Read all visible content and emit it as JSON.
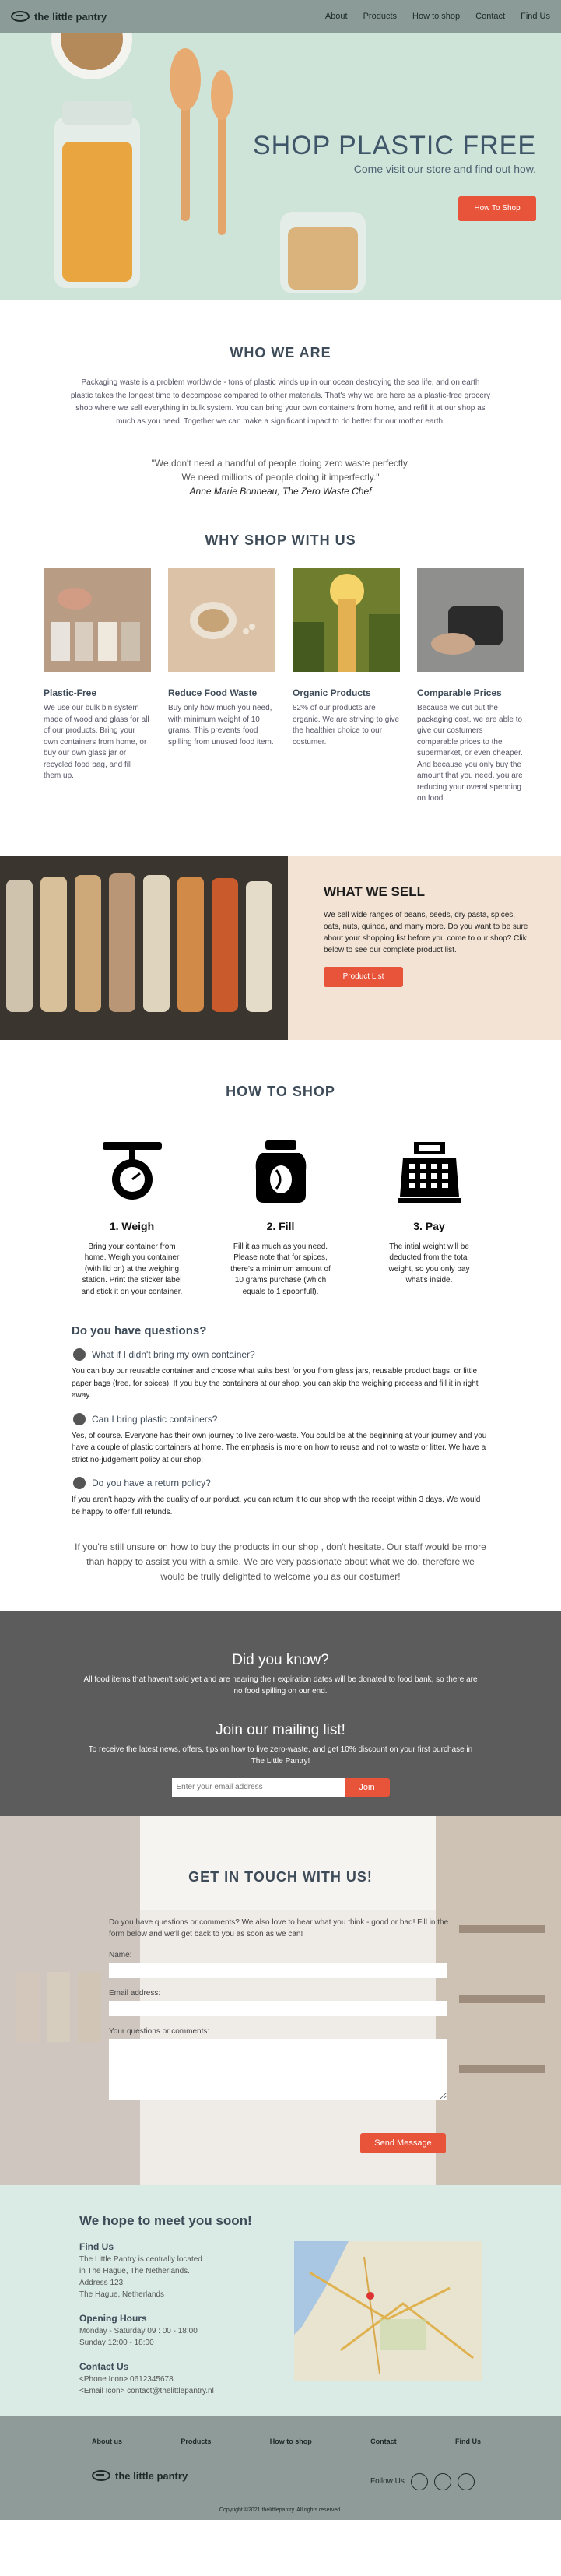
{
  "nav": {
    "brand": "the little pantry",
    "links": [
      "About",
      "Products",
      "How to shop",
      "Contact",
      "Find Us"
    ]
  },
  "hero": {
    "title": "SHOP PLASTIC FREE",
    "subtitle": "Come visit our store and find out how.",
    "button": "How To Shop"
  },
  "who": {
    "title": "WHO WE ARE",
    "text": "Packaging waste is a problem worldwide - tons of plastic winds up in our ocean destroying the sea life, and on earth plastic takes the longest time to decompose compared to other materials. That's why we are here as a plastic-free grocery shop where we sell everything in bulk system. You can bring your own containers from home, and refill it at our shop as much as you need. Together we can make a significant impact to do better for our mother earth!",
    "quote_line1": "\"We don't need a handful of people doing zero waste perfectly.",
    "quote_line2": "We need millions of people doing it imperfectly.\"",
    "quote_author": "Anne Marie Bonneau, The Zero Waste Chef"
  },
  "why": {
    "title": "WHY SHOP WITH US",
    "cards": [
      {
        "title": "Plastic-Free",
        "text": "We use our bulk bin system made of wood and glass for all of our products. Bring your own containers from home, or buy our own glass jar or recycled food bag, and fill them up."
      },
      {
        "title": "Reduce Food Waste",
        "text": "Buy only how much you need, with minimum weight of 10 grams. This prevents food spilling from unused food item."
      },
      {
        "title": "Organic Products",
        "text": "82% of our products are organic. We are striving to give the healthier choice to our costumer."
      },
      {
        "title": "Comparable Prices",
        "text": "Because we cut out the packaging cost, we are able to give our costumers comparable prices to the supermarket, or even cheaper. And because you only buy the amount that you need, you are reducing your overal spending on food."
      }
    ]
  },
  "sell": {
    "title": "WHAT WE SELL",
    "text": "We sell wide ranges of beans, seeds, dry pasta, spices, oats, nuts, quinoa, and many more. Do you want to be sure about your shopping list before you come to our shop? Clik below to see our complete product list.",
    "button": "Product List"
  },
  "how": {
    "title": "HOW TO SHOP",
    "steps": [
      {
        "icon": "scale-icon",
        "title": "1. Weigh",
        "text": "Bring your container from home. Weigh you container (with lid on) at the weighing station. Print the sticker label and stick it on your container."
      },
      {
        "icon": "jar-icon",
        "title": "2. Fill",
        "text": "Fill it as much as you need. Please note that for spices, there's a minimum amount of 10 grams purchase (which equals to 1 spoonfull)."
      },
      {
        "icon": "cash-register-icon",
        "title": "3. Pay",
        "text": "The intial weight will be deducted from the total weight, so you only pay what's inside."
      }
    ]
  },
  "faq": {
    "title": "Do you have questions?",
    "items": [
      {
        "q": "What if I didn't bring my own container?",
        "a": "You can buy our reusable container and choose what suits best for you from glass jars, reusable product bags, or little paper bags (free, for spices). If you buy the containers at our shop, you can skip the weighing process and fill it in right away."
      },
      {
        "q": "Can I bring plastic containers?",
        "a": "Yes, of course. Everyone has their own journey to live zero-waste. You could be at the beginning at your journey and you have a couple of plastic containers at home. The emphasis is more on how to reuse and not to waste or litter. We have a strict no-judgement policy at our shop!"
      },
      {
        "q": "Do you have a return policy?",
        "a": "If you aren't happy with the quality of our porduct, you can return it to our shop with the receipt within 3 days. We would be happy to offer full refunds."
      }
    ],
    "closing": "If you're still unsure on how to buy the products in our shop , don't hesitate. Our staff would be more than happy to assist you with a smile. We are very passionate about what we do, therefore we would be trully delighted to welcome you as our costumer!"
  },
  "know": {
    "title": "Did you know?",
    "text": "All food items that haven't sold yet and are nearing their expiration dates will be donated to food bank, so there are no food spilling on our end."
  },
  "mailing": {
    "title": "Join our mailing list!",
    "text": "To receive the latest news, offers, tips on how to live zero-waste, and get 10% discount on your first purchase in The Little Pantry!",
    "placeholder": "Enter your email address",
    "button": "Join"
  },
  "contact": {
    "title": "GET IN TOUCH WITH US!",
    "text": "Do you have questions or comments? We also love to hear what you think - good or bad! Fill in the form below and we'll get back to you as soon as we can!",
    "name_label": "Name:",
    "email_label": "Email address:",
    "message_label": "Your questions or comments:",
    "button": "Send Message"
  },
  "meet": {
    "title": "We hope to meet you soon!",
    "find_title": "Find Us",
    "find_lines": [
      "The Little Pantry is centrally located",
      "in The Hague, The Netherlands.",
      "Address 123,",
      "The Hague, Netherlands"
    ],
    "hours_title": "Opening Hours",
    "hours_lines": [
      "Monday - Saturday 09 : 00 - 18:00",
      "Sunday 12:00 - 18:00"
    ],
    "contact_title": "Contact Us",
    "contact_lines": [
      "<Phone Icon> 0612345678",
      "<Email Icon> contact@thelittlepantry.nl"
    ]
  },
  "footer": {
    "links": [
      "About us",
      "Products",
      "How to shop",
      "Contact",
      "Find Us"
    ],
    "brand": "the little pantry",
    "follow": "Follow Us",
    "copyright": "Copyright ©2021 thelittlepantry. All rights reserved."
  },
  "colors": {
    "accent": "#e8543a",
    "nav": "#8a9b98",
    "hero_bg": "#cfe4d9",
    "sell_bg": "#f2e3d4",
    "dark_bg": "#5c5c5c",
    "meet_bg": "#d9ebe4",
    "heading": "#3e4b58"
  }
}
